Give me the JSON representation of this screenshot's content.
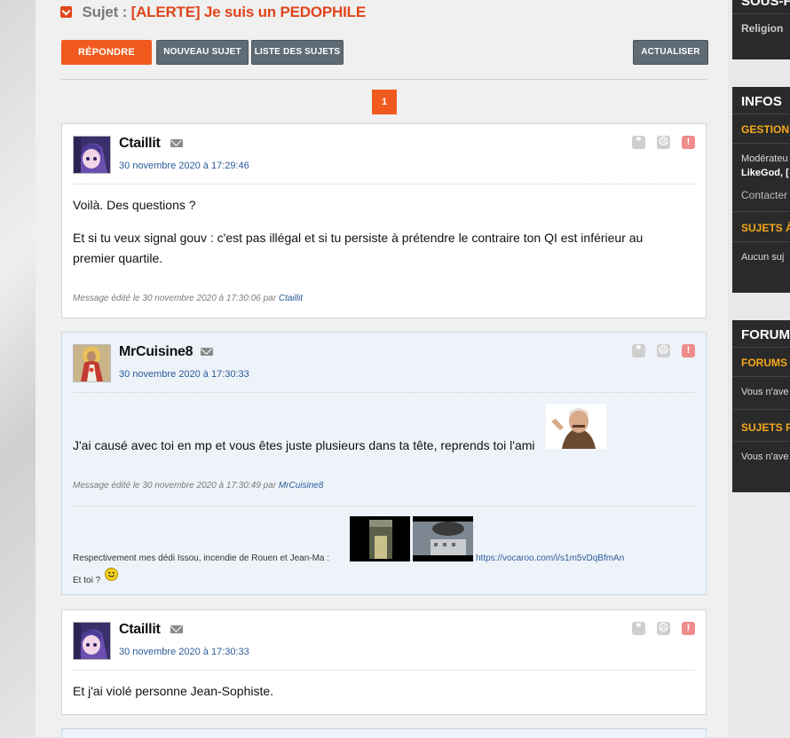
{
  "topic": {
    "label": "Sujet :",
    "title": "[ALERTE] Je suis un PEDOPHILE"
  },
  "toolbar": {
    "reply": "Répondre",
    "new_topic": "Nouveau sujet",
    "topic_list": "Liste des sujets",
    "refresh": "Actualiser"
  },
  "pagination": {
    "current": "1"
  },
  "posts": [
    {
      "author": "Ctaillit",
      "date": "30 novembre 2020 à 17:29:46",
      "paragraphs": [
        "Voilà. Des questions ?",
        "Et si tu veux signal gouv : c'est pas illégal et si tu persiste à prétendre le contraire ton QI est inférieur au premier quartile."
      ],
      "edited_prefix": "Message édité le 30 novembre 2020 à 17:30:06 par",
      "edited_by": "Ctaillit"
    },
    {
      "author": "MrCuisine8",
      "date": "30 novembre 2020 à 17:30:33",
      "paragraphs": [
        "J'ai causé avec toi en mp et vous êtes juste plusieurs dans ta tête, reprends toi l'ami"
      ],
      "edited_prefix": "Message édité le 30 novembre 2020 à 17:30:49 par",
      "edited_by": "MrCuisine8",
      "signature_text": "Respectivement mes dédi Issou, incendie de Rouen et Jean-Ma :",
      "signature_link": "https://vocaroo.com/i/s1m5vDqBfmAn",
      "signature_line2": "Et toi ?"
    },
    {
      "author": "Ctaillit",
      "date": "30 novembre 2020 à 17:30:33",
      "paragraphs": [
        "Et j'ai violé personne Jean-Sophiste."
      ]
    }
  ],
  "sidebar": {
    "block1": {
      "heading": "SOUS-FO",
      "item": "Religion"
    },
    "block2": {
      "heading": "INFOS",
      "sub1": "GESTION D",
      "line1": "Modérateu",
      "line2": "LikeGod, [",
      "line3": "Contacter",
      "sub2": "SUJETS À",
      "line4": "Aucun suj"
    },
    "block3": {
      "heading": "FORUMS",
      "sub1": "FORUMS F",
      "line1": "Vous n'ave",
      "sub2": "SUJETS FA",
      "line2": "Vous n'ave"
    }
  },
  "colors": {
    "accent": "#f05a1e",
    "title": "#e0451b",
    "link": "#2a5c9a",
    "sidebar_sub": "#f4a81b"
  },
  "icons": [
    "chevron-down-icon",
    "mail-icon",
    "quote-icon",
    "sad-face-icon",
    "alert-icon",
    "smiley-icon"
  ]
}
